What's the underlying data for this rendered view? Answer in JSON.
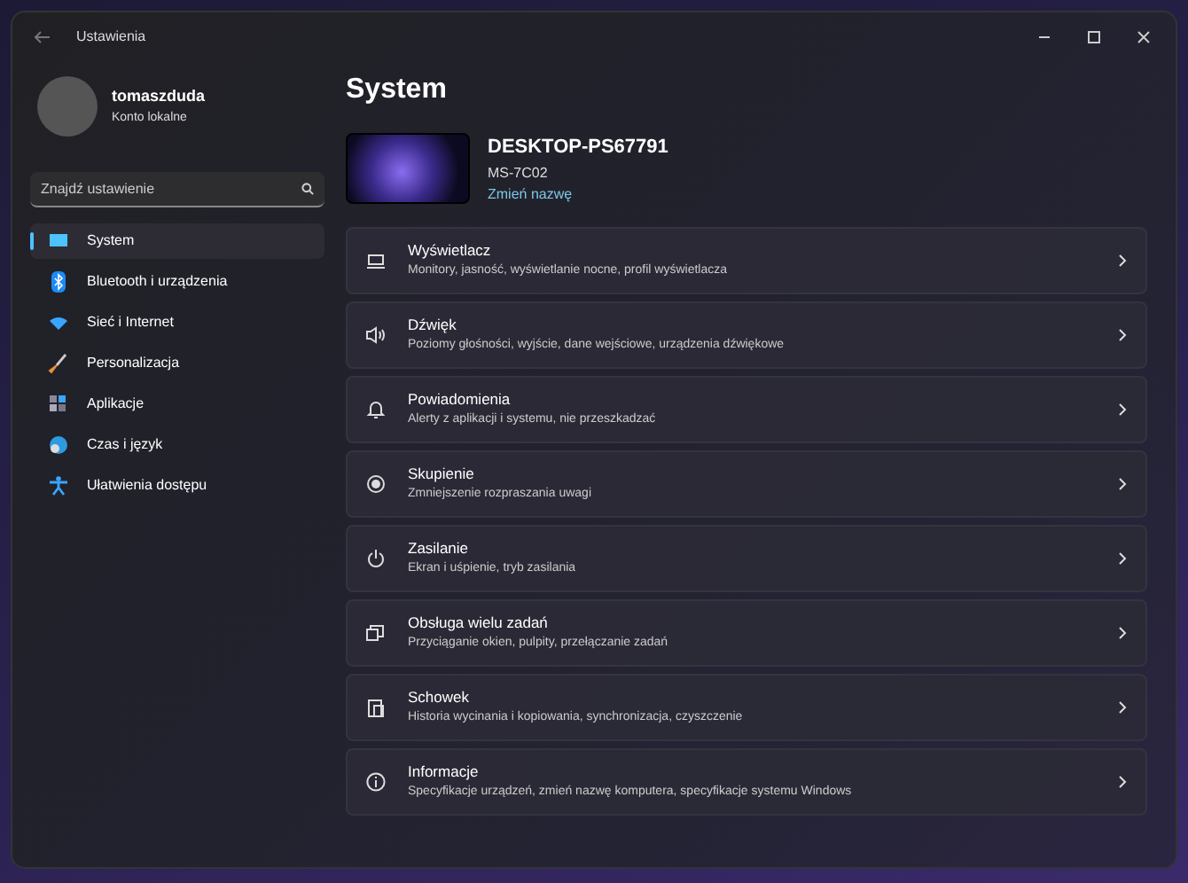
{
  "window": {
    "title": "Ustawienia"
  },
  "account": {
    "name": "tomaszduda",
    "type": "Konto lokalne"
  },
  "search": {
    "placeholder": "Znajdź ustawienie"
  },
  "sidebar": {
    "items": [
      {
        "label": "System",
        "selected": true
      },
      {
        "label": "Bluetooth i urządzenia",
        "selected": false
      },
      {
        "label": "Sieć i Internet",
        "selected": false
      },
      {
        "label": "Personalizacja",
        "selected": false
      },
      {
        "label": "Aplikacje",
        "selected": false
      },
      {
        "label": "Czas i język",
        "selected": false
      },
      {
        "label": "Ułatwienia dostępu",
        "selected": false
      }
    ]
  },
  "page": {
    "title": "System"
  },
  "device": {
    "name": "DESKTOP-PS67791",
    "model": "MS-7C02",
    "rename_link": "Zmień nazwę"
  },
  "settings": [
    {
      "title": "Wyświetlacz",
      "description": "Monitory, jasność, wyświetlanie nocne, profil wyświetlacza"
    },
    {
      "title": "Dźwięk",
      "description": "Poziomy głośności, wyjście, dane wejściowe, urządzenia dźwiękowe"
    },
    {
      "title": "Powiadomienia",
      "description": "Alerty z aplikacji i systemu, nie przeszkadzać"
    },
    {
      "title": "Skupienie",
      "description": "Zmniejszenie rozpraszania uwagi"
    },
    {
      "title": "Zasilanie",
      "description": "Ekran i uśpienie, tryb zasilania"
    },
    {
      "title": "Obsługa wielu zadań",
      "description": "Przyciąganie okien, pulpity, przełączanie zadań"
    },
    {
      "title": "Schowek",
      "description": "Historia wycinania i kopiowania, synchronizacja, czyszczenie"
    },
    {
      "title": "Informacje",
      "description": "Specyfikacje urządzeń, zmień nazwę komputera, specyfikacje systemu Windows"
    }
  ]
}
